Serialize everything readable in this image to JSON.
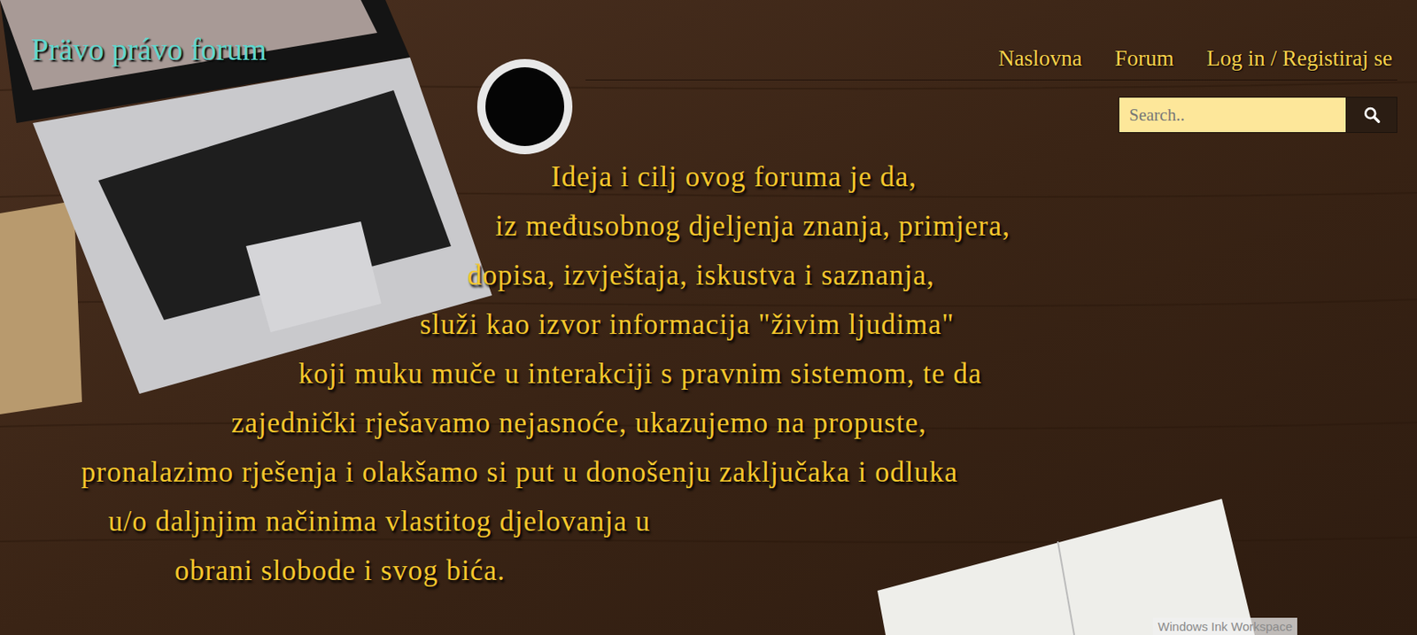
{
  "site_title": "Prävo právo forum",
  "nav": [
    {
      "label": "Naslovna"
    },
    {
      "label": "Forum"
    },
    {
      "label": "Log in / Registiraj se"
    }
  ],
  "search": {
    "placeholder": "Search.."
  },
  "intro_lines": [
    "Ideja i cilj ovog foruma je da,",
    "iz međusobnog djeljenja znanja, primjera,",
    "dopisa, izvještaja, iskustva i saznanja,",
    "služi kao izvor informacija \"živim ljudima\"",
    "koji muku muče u interakciji s pravnim sistemom, te da",
    "zajednički rješavamo nejasnoće, ukazujemo na propuste,",
    "pronalazimo rješenja i olakšamo si put u donošenju zaključaka i odluka",
    "u/o daljnjim načinima vlastitog djelovanja u",
    "obrani slobode i svog bića."
  ],
  "overlay": {
    "label": "Windows Ink Workspace"
  }
}
